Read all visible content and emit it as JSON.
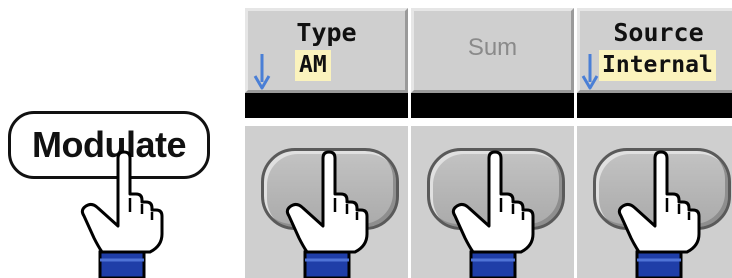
{
  "front_key": {
    "label": "Modulate"
  },
  "softkeys": [
    {
      "title": "Type",
      "value": "AM",
      "has_arrow": true,
      "state": "active"
    },
    {
      "label": "Sum",
      "state": "disabled"
    },
    {
      "title": "Source",
      "value": "Internal",
      "has_arrow": true,
      "state": "active"
    }
  ],
  "icons": {
    "arrow": "down-arrow-icon",
    "hand": "pointing-hand-icon"
  },
  "colors": {
    "softkey_bg": "#cfcfcf",
    "value_highlight": "#fbf3bd",
    "arrow": "#4a7fd6",
    "sleeve": "#1f3ea8",
    "disabled_text": "#8a8a8a"
  }
}
